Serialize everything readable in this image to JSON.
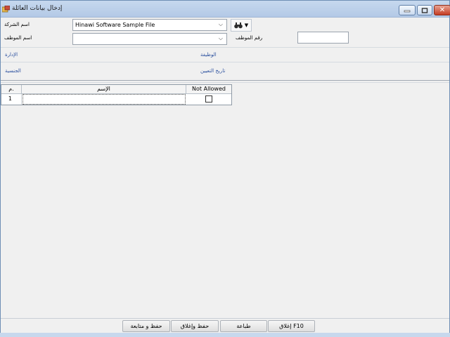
{
  "window": {
    "title": "إدخال بيانات العائلة"
  },
  "form": {
    "company_label": "اسم الشركة",
    "company_value": "Hinawi Software Sample File",
    "employee_name_label": "اسم الموظف",
    "employee_name_value": "",
    "employee_number_label": "رقم الموظف",
    "employee_number_value": "",
    "job_label": "الوظيفة",
    "department_label": "الإدارة",
    "hire_date_label": "تاريخ التعيين",
    "nationality_label": "الجنسية"
  },
  "grid": {
    "columns": [
      "م.",
      "الإسم",
      "Not Allowed"
    ],
    "rows": [
      {
        "index": "1",
        "name": "",
        "not_allowed": false
      }
    ]
  },
  "buttons": {
    "save_continue": "حفظ و متابعة",
    "save_close": "حفظ وإغلاق",
    "print": "طباعة",
    "close": "F10 إغلاق"
  },
  "icons": {
    "search": "binoculars-icon",
    "app": "app-icon"
  }
}
